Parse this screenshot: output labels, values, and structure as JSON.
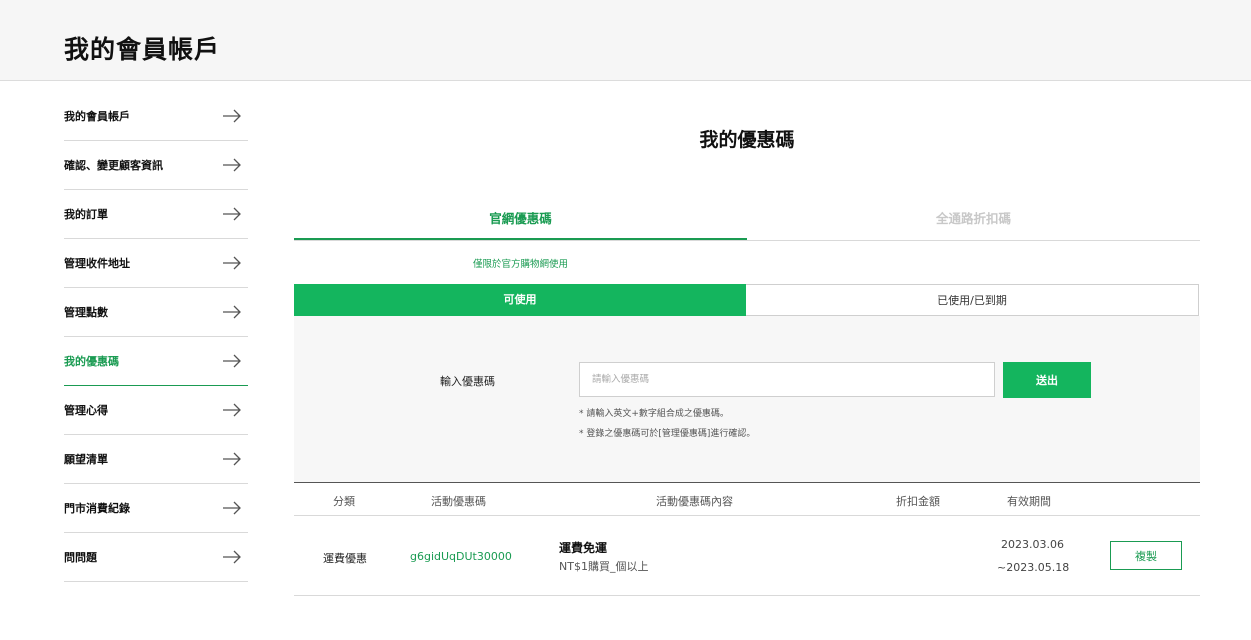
{
  "header": {
    "title": "我的會員帳戶"
  },
  "sidebar": {
    "items": [
      {
        "label": "我的會員帳戶"
      },
      {
        "label": "確認、變更顧客資訊"
      },
      {
        "label": "我的訂單"
      },
      {
        "label": "管理收件地址"
      },
      {
        "label": "管理點數"
      },
      {
        "label": "我的優惠碼"
      },
      {
        "label": "管理心得"
      },
      {
        "label": "願望清單"
      },
      {
        "label": "門市消費紀錄"
      },
      {
        "label": "問問題"
      }
    ],
    "active_index": 5
  },
  "main": {
    "title": "我的優惠碼",
    "tabs": [
      {
        "label": "官網優惠碼"
      },
      {
        "label": "全通路折扣碼"
      }
    ],
    "note": "僅限於官方購物網使用",
    "subtabs": [
      {
        "label": "可使用"
      },
      {
        "label": "已使用/已到期"
      }
    ],
    "coupon_form": {
      "label": "輸入優惠碼",
      "placeholder": "請輸入優惠碼",
      "submit_label": "送出",
      "hint1": "* 請輸入英文+數字組合成之優惠碼。",
      "hint2": "* 登錄之優惠碼可於[管理優惠碼]進行確認。"
    },
    "table": {
      "headers": [
        "分類",
        "活動優惠碼",
        "活動優惠碼內容",
        "折扣金額",
        "有效期間"
      ],
      "rows": [
        {
          "category": "運費優惠",
          "code": "g6gidUqDUt30000",
          "content_title": "運費免運",
          "content_desc": "NT$1購買_個以上",
          "date_start": "2023.03.06",
          "date_end": "~2023.05.18",
          "copy_label": "複製"
        }
      ]
    }
  },
  "colors": {
    "accent": "#14b55e",
    "accent_text": "#1a9b52"
  }
}
